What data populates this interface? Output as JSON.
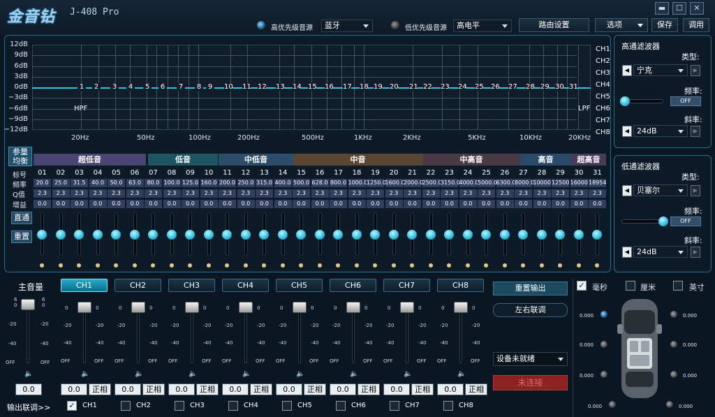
{
  "app": {
    "logo": "金音钻",
    "model": "J-408 Pro"
  },
  "window": {
    "min": "▬",
    "restore": "☐",
    "close": "✕"
  },
  "header": {
    "high_src_label": "高优先级音源",
    "high_src_value": "蓝牙",
    "low_src_label": "低优先级音源",
    "low_src_value": "高电平",
    "routing": "路由设置",
    "options": "选项",
    "save": "保存",
    "load": "调用"
  },
  "graph": {
    "y_ticks": [
      "12dB",
      "9dB",
      "6dB",
      "3dB",
      "0dB",
      "−3dB",
      "−6dB",
      "−9dB",
      "−12dB"
    ],
    "x_ticks": [
      "20Hz",
      "50Hz",
      "100Hz",
      "200Hz",
      "500Hz",
      "1KHz",
      "2KHz",
      "5KHz",
      "10KHz",
      "20KHz"
    ],
    "points": [
      "1",
      "2",
      "3",
      "4",
      "5",
      "6",
      "7",
      "8",
      "9",
      "10",
      "11",
      "12",
      "13",
      "14",
      "15",
      "16",
      "17",
      "18",
      "19",
      "20",
      "21",
      "22",
      "23",
      "24",
      "25",
      "26",
      "27",
      "28",
      "29",
      "30",
      "31"
    ],
    "hpf": "HPF",
    "lpf": "LPF",
    "channels": [
      "CH1",
      "CH2",
      "CH3",
      "CH4",
      "CH5",
      "CH6",
      "CH7",
      "CH8"
    ]
  },
  "eq": {
    "toggle": [
      "参量",
      "均衡"
    ],
    "bands": [
      {
        "label": "超低音",
        "color": "#4a4573"
      },
      {
        "label": "低音",
        "color": "#1d5560"
      },
      {
        "label": "中低音",
        "color": "#2d4e6b"
      },
      {
        "label": "中音",
        "color": "#5a4632"
      },
      {
        "label": "中高音",
        "color": "#4a3a46"
      },
      {
        "label": "高音",
        "color": "#2a4a6a"
      },
      {
        "label": "超高音",
        "color": "#4a3a5a"
      }
    ],
    "row_labels": {
      "index": "标号",
      "freq": "频率",
      "q": "Q值",
      "gain": "增益"
    },
    "freqs": [
      "20.0",
      "25.0",
      "31.5",
      "40.0",
      "50.0",
      "63.0",
      "80.0",
      "100.0",
      "125.0",
      "160.0",
      "200.0",
      "250.0",
      "315.0",
      "400.0",
      "500.0",
      "628.0",
      "800.0",
      "1000.0",
      "1250.0",
      "1600.0",
      "2000.0",
      "2500.0",
      "3150.0",
      "4000.0",
      "5000.0",
      "6300.0",
      "8000.0",
      "10000",
      "12500",
      "16000",
      "18954"
    ],
    "q": "2.3",
    "gain": "0.0",
    "bypass": "直通",
    "reset": "重置"
  },
  "hpf_panel": {
    "title": "高通滤波器",
    "type_label": "类型:",
    "type": "宁克",
    "freq_label": "频率:",
    "off": "OFF",
    "slope_label": "斜率:",
    "slope": "24dB"
  },
  "lpf_panel": {
    "title": "低通滤波器",
    "type_label": "类型:",
    "type": "贝塞尔",
    "freq_label": "频率:",
    "off": "OFF",
    "slope_label": "斜率:",
    "slope": "24dB"
  },
  "master": {
    "label": "主音量",
    "value": "0.0",
    "ticks": [
      "6",
      "0",
      "-20",
      "-40",
      "OFF"
    ]
  },
  "channels": [
    {
      "label": "CH1",
      "value": "0.0",
      "phase": "正相",
      "active": true
    },
    {
      "label": "CH2",
      "value": "0.0",
      "phase": "正相",
      "active": false
    },
    {
      "label": "CH3",
      "value": "0.0",
      "phase": "正相",
      "active": false
    },
    {
      "label": "CH4",
      "value": "0.0",
      "phase": "正相",
      "active": false
    },
    {
      "label": "CH5",
      "value": "0.0",
      "phase": "正相",
      "active": false
    },
    {
      "label": "CH6",
      "value": "0.0",
      "phase": "正相",
      "active": false
    },
    {
      "label": "CH7",
      "value": "0.0",
      "phase": "正相",
      "active": false
    },
    {
      "label": "CH8",
      "value": "0.0",
      "phase": "正相",
      "active": false
    }
  ],
  "fader_ticks": [
    "0",
    "-20",
    "-40",
    "OFF"
  ],
  "link": {
    "label": "输出联调>>",
    "items": [
      {
        "label": "CH1",
        "checked": true
      },
      {
        "label": "CH2",
        "checked": false
      },
      {
        "label": "CH3",
        "checked": false
      },
      {
        "label": "CH4",
        "checked": false
      },
      {
        "label": "CH5",
        "checked": false
      },
      {
        "label": "CH6",
        "checked": false
      },
      {
        "label": "CH7",
        "checked": false
      },
      {
        "label": "CH8",
        "checked": false
      }
    ]
  },
  "actions": {
    "reset_output": "重置输出",
    "lr_link": "左右联调",
    "device": "设备未就绪",
    "connect": "未连接"
  },
  "units": {
    "ms": "毫秒",
    "cm": "厘米",
    "inch": "英寸"
  },
  "delays": [
    "0.000",
    "0.000",
    "0.000",
    "0.000",
    "0.000",
    "0.000",
    "0.000",
    "0.000"
  ]
}
